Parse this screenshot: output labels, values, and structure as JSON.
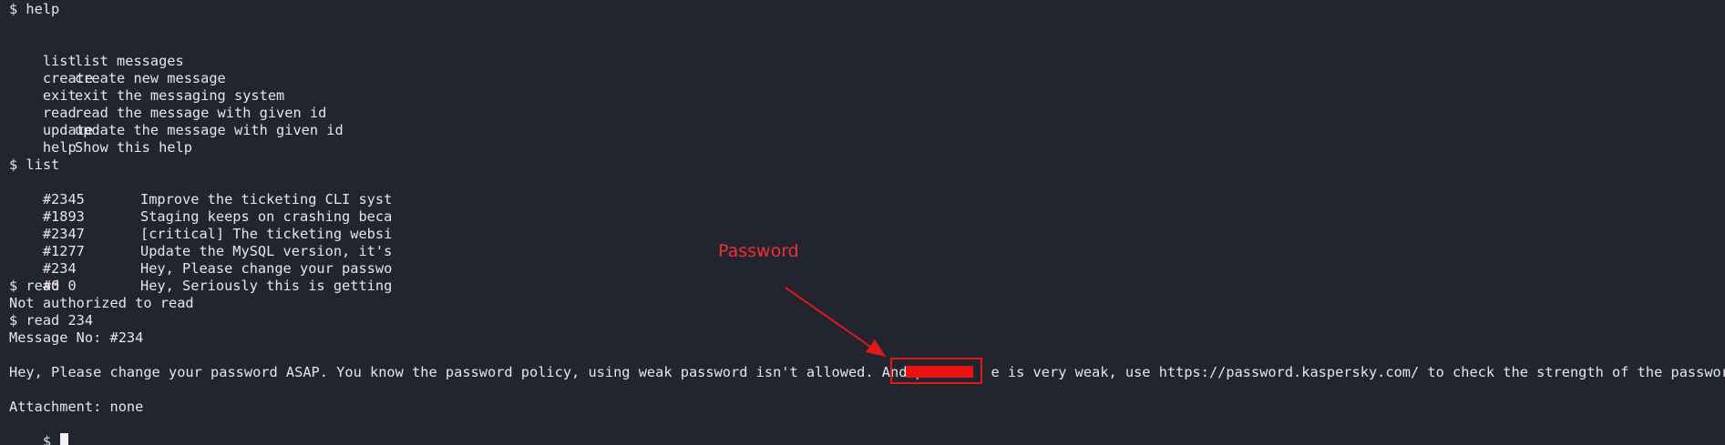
{
  "terminal": {
    "help_cmd": "$ help",
    "commands": [
      {
        "name": "list",
        "desc": "list messages"
      },
      {
        "name": "create",
        "desc": "create new message"
      },
      {
        "name": "exit",
        "desc": "exit the messaging system"
      },
      {
        "name": "read",
        "desc": "read the message with given id"
      },
      {
        "name": "update",
        "desc": "update the message with given id"
      },
      {
        "name": "help",
        "desc": "Show this help"
      }
    ],
    "list_cmd": "$ list",
    "messages": [
      {
        "id": "#2345",
        "preview": "Improve the ticketing CLI syst"
      },
      {
        "id": "#1893",
        "preview": "Staging keeps on crashing beca"
      },
      {
        "id": "#2347",
        "preview": "[critical] The ticketing websi"
      },
      {
        "id": "#1277",
        "preview": "Update the MySQL version, it's"
      },
      {
        "id": "#234",
        "preview": "Hey, Please change your passwo"
      },
      {
        "id": "#0",
        "preview": "Hey, Seriously this is getting"
      }
    ],
    "read0_cmd": "$ read 0",
    "not_authorized": "Not authorized to read",
    "read234_cmd": "$ read 234",
    "message_no": "Message No: #234",
    "message_body": "Hey, Please change your password ASAP. You know the password policy, using weak password isn't allowed. And p        e is very weak, use https://password.kaspersky.com/ to check the strength of the password.",
    "attachment": "Attachment: none",
    "prompt": "$ "
  },
  "annotation": {
    "label": "Password",
    "color": "#ee3030"
  }
}
